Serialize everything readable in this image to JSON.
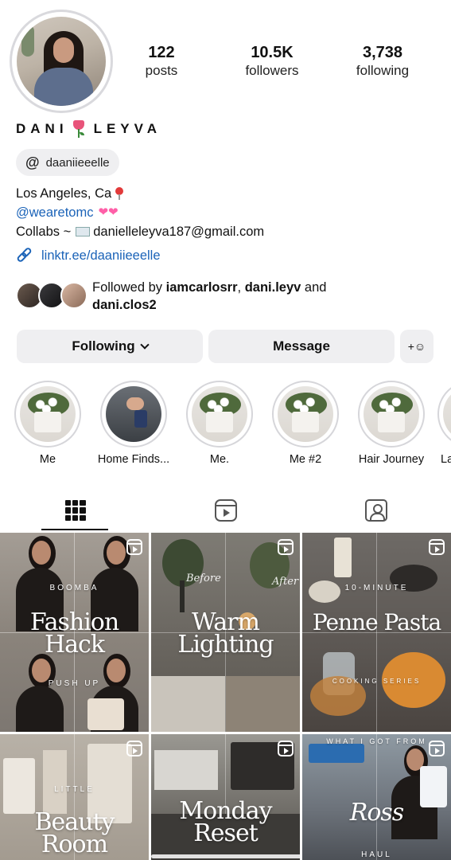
{
  "profile": {
    "name": "DANI",
    "surname": "LEYVA",
    "stats": [
      {
        "value": "122",
        "label": "posts"
      },
      {
        "value": "10.5K",
        "label": "followers"
      },
      {
        "value": "3,738",
        "label": "following"
      }
    ],
    "threads_handle": "daaniieeelle",
    "bio": {
      "location": "Los Angeles, Ca",
      "mention": "@wearetomc",
      "collabs_prefix": "Collabs ~",
      "email": "danielleleyva187@gmail.com",
      "link": "linktr.ee/daaniieeelle"
    },
    "followed_by": {
      "prefix": "Followed by",
      "user1": "iamcarlosrr",
      "user2": "dani.leyv",
      "joiner": "and",
      "user3": "dani.clos2"
    }
  },
  "actions": {
    "following_label": "Following",
    "message_label": "Message"
  },
  "highlights": [
    {
      "label": "Me"
    },
    {
      "label": "Home Finds..."
    },
    {
      "label": "Me."
    },
    {
      "label": "Me #2"
    },
    {
      "label": "Hair Journey"
    },
    {
      "label": "La"
    }
  ],
  "tabs": [
    "grid-icon",
    "reels-icon",
    "tagged-icon"
  ],
  "posts": [
    {
      "top_text": "BOOMBA",
      "title_line1": "Fashion",
      "title_line2": "Hack",
      "bottom_text": "PUSH UP"
    },
    {
      "script_left": "Before",
      "script_right": "After",
      "title_line1": "Warm",
      "title_line2": "Lighting"
    },
    {
      "top_text": "10-MINUTE",
      "title_line1": "Penne Pasta",
      "bottom_text": "COOKING SERIES"
    },
    {
      "top_text": "LITTLE",
      "title_line1": "Beauty",
      "title_line2": "Room"
    },
    {
      "title_line1": "Monday",
      "title_line2": "Reset"
    },
    {
      "top_text": "WHAT I GOT FROM",
      "title_line1": "Ross",
      "bottom_text": "HAUL"
    }
  ],
  "colors": {
    "link_blue": "#1b63b8",
    "button_bg": "#efeff1"
  }
}
